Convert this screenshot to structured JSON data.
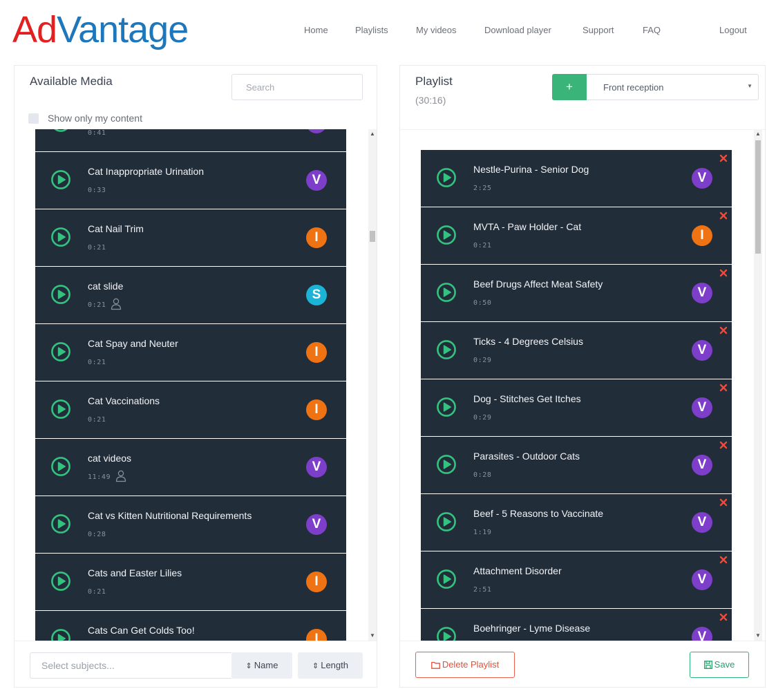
{
  "brand": {
    "part1": "Ad",
    "part2": "Vantage",
    "color1": "#e2201f",
    "color2": "#1e76bb"
  },
  "nav": [
    {
      "label": "Home",
      "key": "home"
    },
    {
      "label": "Playlists",
      "key": "playlists"
    },
    {
      "label": "My videos",
      "key": "my-videos"
    },
    {
      "label": "Download player",
      "key": "download-player"
    },
    {
      "label": "Support",
      "key": "support"
    },
    {
      "label": "FAQ",
      "key": "faq"
    },
    {
      "label": "Logout",
      "key": "logout"
    }
  ],
  "available_media": {
    "title": "Available Media",
    "search_placeholder": "Search",
    "show_only_mine_label": "Show only my content",
    "items": [
      {
        "title": "",
        "duration": "0:41",
        "badge": "V",
        "mine": false
      },
      {
        "title": "Cat Inappropriate Urination",
        "duration": "0:33",
        "badge": "V",
        "mine": false
      },
      {
        "title": "Cat Nail Trim",
        "duration": "0:21",
        "badge": "I",
        "mine": false
      },
      {
        "title": "cat slide",
        "duration": "0:21",
        "badge": "S",
        "mine": true
      },
      {
        "title": "Cat Spay and Neuter",
        "duration": "0:21",
        "badge": "I",
        "mine": false
      },
      {
        "title": "Cat Vaccinations",
        "duration": "0:21",
        "badge": "I",
        "mine": false
      },
      {
        "title": "cat videos",
        "duration": "11:49",
        "badge": "V",
        "mine": true
      },
      {
        "title": "Cat vs Kitten Nutritional Requirements",
        "duration": "0:28",
        "badge": "V",
        "mine": false
      },
      {
        "title": "Cats and Easter Lilies",
        "duration": "0:21",
        "badge": "I",
        "mine": false
      },
      {
        "title": "Cats Can Get Colds Too!",
        "duration": "",
        "badge": "I",
        "mine": false
      }
    ],
    "subjects_placeholder": "Select subjects...",
    "sort_name_label": "Name",
    "sort_length_label": "Length"
  },
  "playlist": {
    "title": "Playlist",
    "total_duration": "(30:16)",
    "add_label": "+",
    "selected_playlist": "Front reception",
    "items": [
      {
        "title": "Nestle-Purina - Senior Dog",
        "duration": "2:25",
        "badge": "V"
      },
      {
        "title": "MVTA - Paw Holder - Cat",
        "duration": "0:21",
        "badge": "I"
      },
      {
        "title": "Beef Drugs Affect Meat Safety",
        "duration": "0:50",
        "badge": "V"
      },
      {
        "title": "Ticks - 4 Degrees Celsius",
        "duration": "0:29",
        "badge": "V"
      },
      {
        "title": "Dog - Stitches Get Itches",
        "duration": "0:29",
        "badge": "V"
      },
      {
        "title": "Parasites - Outdoor Cats",
        "duration": "0:28",
        "badge": "V"
      },
      {
        "title": "Beef - 5 Reasons to Vaccinate",
        "duration": "1:19",
        "badge": "V"
      },
      {
        "title": "Attachment Disorder",
        "duration": "2:51",
        "badge": "V"
      },
      {
        "title": "Boehringer - Lyme Disease",
        "duration": "",
        "badge": "V"
      }
    ],
    "delete_label": "Delete Playlist",
    "save_label": "Save"
  },
  "badge_colors": {
    "V": "#7d3fc9",
    "I": "#f07313",
    "S": "#1bb3d6"
  },
  "colors": {
    "row_bg": "#222d3a",
    "play_green": "#33c27f",
    "remove_red": "#f04a3a"
  }
}
